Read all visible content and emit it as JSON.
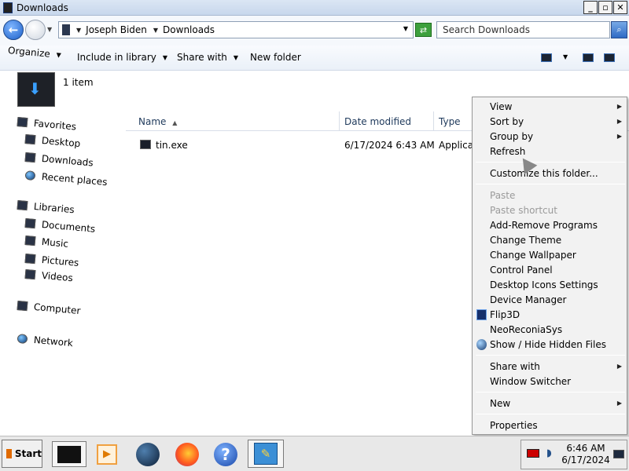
{
  "window": {
    "title": "Downloads",
    "buttons": {
      "minimize": "_",
      "maximize": "▫",
      "close": "✕"
    }
  },
  "address": {
    "crumbs": [
      "Joseph Biden",
      "Downloads"
    ],
    "search_placeholder": "Search Downloads"
  },
  "commands": {
    "organize": "Organize",
    "include_in_library": "Include in library",
    "share_with": "Share with",
    "new_folder": "New folder"
  },
  "details": {
    "item_count": "1 item"
  },
  "nav": {
    "favorites": "Favorites",
    "desktop": "Desktop",
    "downloads": "Downloads",
    "recent_places": "Recent places",
    "libraries": "Libraries",
    "documents": "Documents",
    "music": "Music",
    "pictures": "Pictures",
    "videos": "Videos",
    "computer": "Computer",
    "network": "Network"
  },
  "columns": {
    "name": "Name",
    "date_modified": "Date modified",
    "type": "Type"
  },
  "files": [
    {
      "name": "tin.exe",
      "date": "6/17/2024 6:43 AM",
      "type": "Applicat"
    }
  ],
  "context_menu": {
    "view": "View",
    "sort_by": "Sort by",
    "group_by": "Group by",
    "refresh": "Refresh",
    "customize": "Customize this folder...",
    "paste": "Paste",
    "paste_shortcut": "Paste shortcut",
    "add_remove": "Add-Remove Programs",
    "change_theme": "Change Theme",
    "change_wallpaper": "Change Wallpaper",
    "control_panel": "Control Panel",
    "desktop_icons": "Desktop Icons Settings",
    "device_manager": "Device Manager",
    "flip3d": "Flip3D",
    "neoreconia": "NeoReconiaSys",
    "show_hide": "Show / Hide Hidden Files",
    "share_with": "Share with",
    "window_switcher": "Window Switcher",
    "new": "New",
    "properties": "Properties"
  },
  "taskbar": {
    "start": "Start",
    "clock_time": "6:46 AM",
    "clock_date": "6/17/2024"
  }
}
